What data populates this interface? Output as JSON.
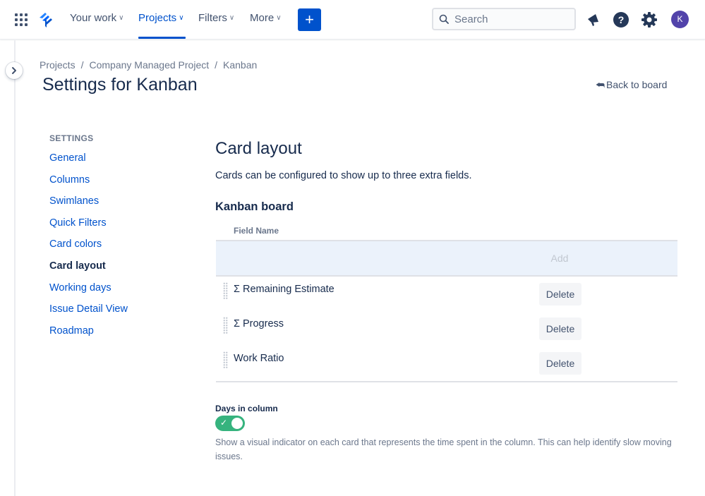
{
  "nav": {
    "your_work": "Your work",
    "projects": "Projects",
    "filters": "Filters",
    "more": "More",
    "create": "+",
    "search_placeholder": "Search",
    "avatar_initial": "K",
    "accent_color": "#0052cc"
  },
  "breadcrumb": {
    "items": [
      "Projects",
      "Company Managed Project",
      "Kanban"
    ],
    "separator": "/"
  },
  "page": {
    "title": "Settings for Kanban",
    "back_link": "Back to board"
  },
  "settings_nav": {
    "heading": "SETTINGS",
    "items": [
      "General",
      "Columns",
      "Swimlanes",
      "Quick Filters",
      "Card colors",
      "Card layout",
      "Working days",
      "Issue Detail View",
      "Roadmap"
    ],
    "current": "Card layout"
  },
  "card_layout": {
    "title": "Card layout",
    "description": "Cards can be configured to show up to three extra fields.",
    "board_heading": "Kanban board",
    "column_header": "Field Name",
    "add_label": "Add",
    "delete_label": "Delete",
    "fields": [
      "Σ Remaining Estimate",
      "Σ Progress",
      "Work Ratio"
    ]
  },
  "days_in_column": {
    "label": "Days in column",
    "enabled": true,
    "toggle_color": "#36b37e",
    "help": "Show a visual indicator on each card that represents the time spent in the column. This can help identify slow moving issues."
  }
}
